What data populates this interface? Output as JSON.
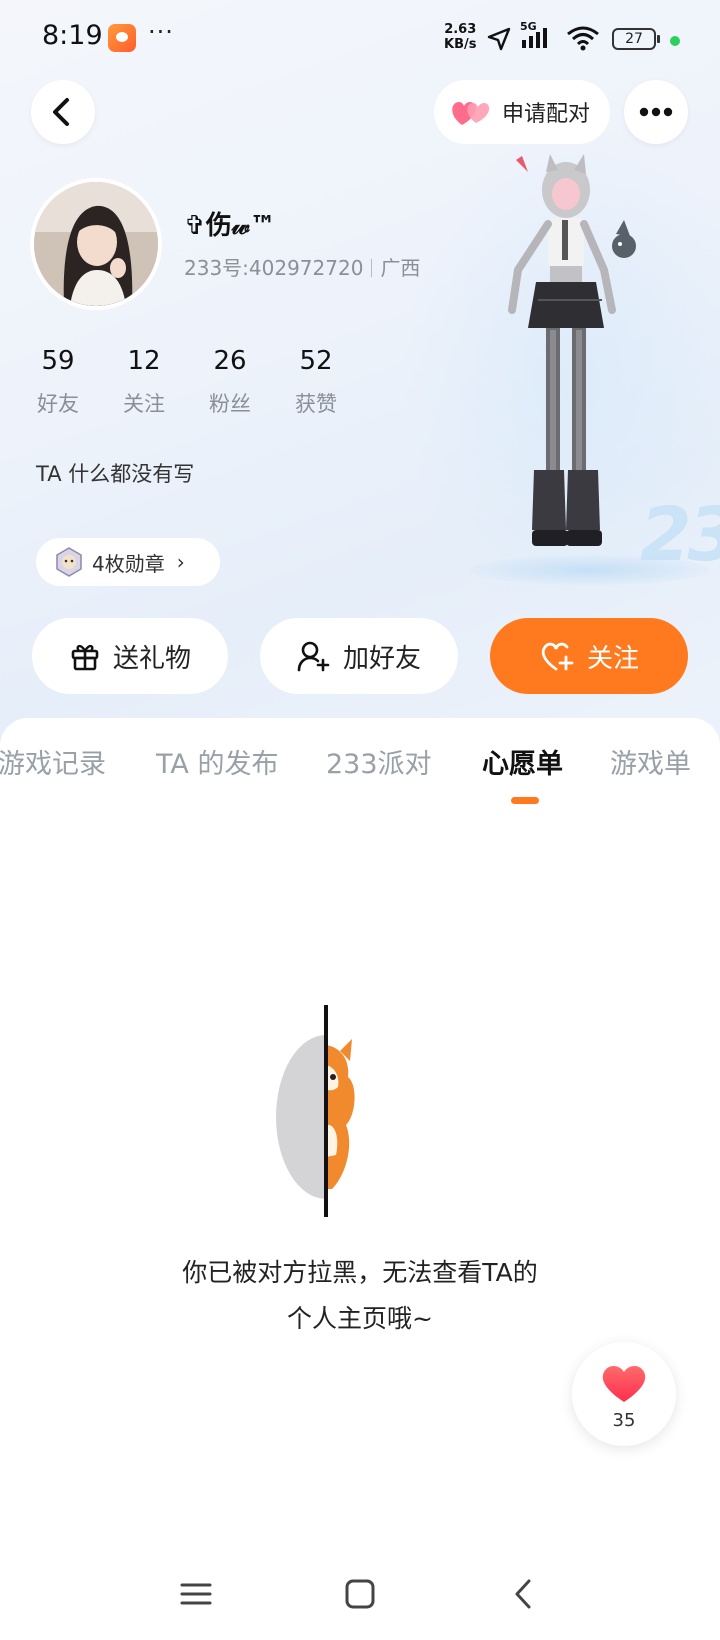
{
  "status_bar": {
    "time": "8:19",
    "more": "···",
    "net_speed_value": "2.63",
    "net_speed_unit": "KB/s",
    "network": "5G",
    "battery": "27"
  },
  "header": {
    "back_icon": "back-arrow-icon",
    "match_label": "申请配对",
    "match_icon": "double-heart-icon",
    "more_icon": "more-dots-icon"
  },
  "profile": {
    "name": "✞伤𝓌™",
    "uid": "233号:402972720",
    "region": "广西",
    "bio": "TA 什么都没有写",
    "medals_label": "4枚勋章",
    "stats": [
      {
        "value": "59",
        "label": "好友"
      },
      {
        "value": "12",
        "label": "关注"
      },
      {
        "value": "26",
        "label": "粉丝"
      },
      {
        "value": "52",
        "label": "获赞"
      }
    ]
  },
  "actions": {
    "gift": "送礼物",
    "add_friend": "加好友",
    "follow": "关注"
  },
  "tabs": [
    {
      "label": "游戏记录",
      "active": false
    },
    {
      "label": "TA 的发布",
      "active": false
    },
    {
      "label": "233派对",
      "active": false
    },
    {
      "label": "心愿单",
      "active": true
    },
    {
      "label": "游戏单",
      "active": false
    }
  ],
  "empty_state": {
    "line1": "你已被对方拉黑，无法查看TA的",
    "line2": "个人主页哦~"
  },
  "like_fab": {
    "count": "35"
  },
  "colors": {
    "accent": "#ff7a1f",
    "like": "#ff3b4e",
    "muted_text": "#8a8f99"
  }
}
